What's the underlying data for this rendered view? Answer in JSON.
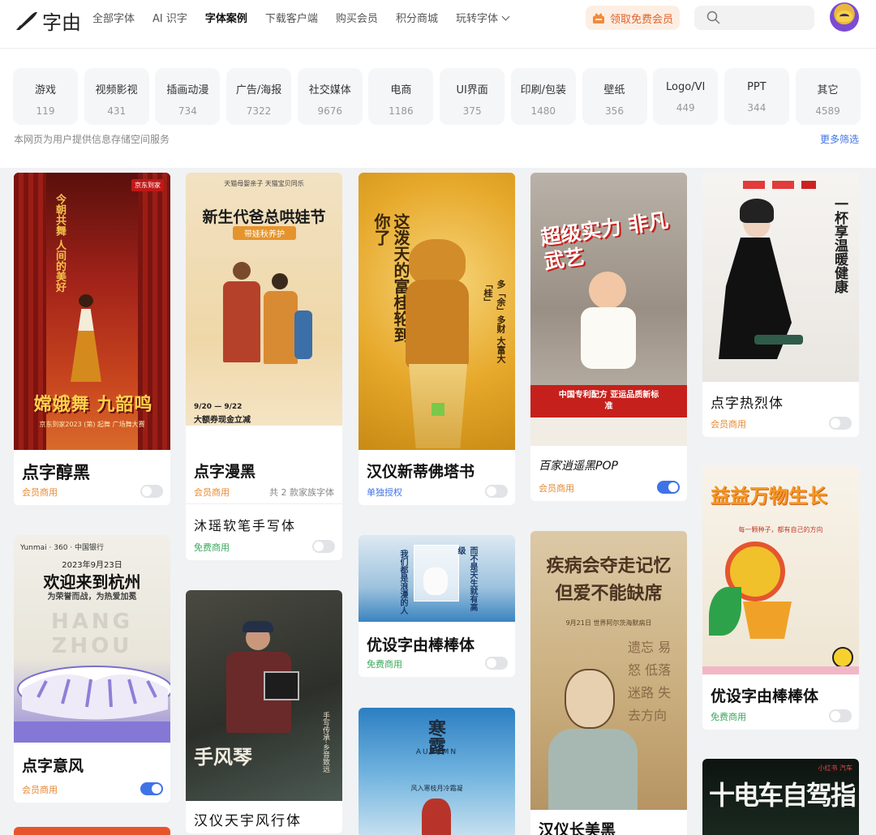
{
  "header": {
    "logo_text": "字由",
    "nav": [
      {
        "label": "全部字体"
      },
      {
        "label": "AI 识字"
      },
      {
        "label": "字体案例"
      },
      {
        "label": "下载客户端"
      },
      {
        "label": "购买会员"
      },
      {
        "label": "积分商城"
      },
      {
        "label": "玩转字体"
      }
    ],
    "vip_button": "领取免费会员",
    "search_placeholder": ""
  },
  "categories": [
    {
      "label": "游戏",
      "count": "119"
    },
    {
      "label": "视频影视",
      "count": "431"
    },
    {
      "label": "插画动漫",
      "count": "734"
    },
    {
      "label": "广告/海报",
      "count": "7322"
    },
    {
      "label": "社交媒体",
      "count": "9676"
    },
    {
      "label": "电商",
      "count": "1186"
    },
    {
      "label": "UI界面",
      "count": "375"
    },
    {
      "label": "印刷/包装",
      "count": "1480"
    },
    {
      "label": "壁纸",
      "count": "356"
    },
    {
      "label": "Logo/VI",
      "count": "449"
    },
    {
      "label": "PPT",
      "count": "344"
    },
    {
      "label": "其它",
      "count": "4589"
    }
  ],
  "notice": "本网页为用户提供信息存储空间服务",
  "more_filter": "更多筛选",
  "cards": {
    "c1": {
      "title": "点字醇黑",
      "license": "会员商用",
      "toggle_on": false,
      "poster_text": "嫦娥舞 九韶鸣",
      "poster_small": "京东到家2023 (第) 起舞 广场舞大赛",
      "poster_top": "京东到家",
      "poster_side": "今朝共舞 人间的美好"
    },
    "c2": {
      "title": "点字漫黑",
      "license": "会员商用",
      "family": "共 2 款家族字体",
      "title2": "沐瑶软笔手写体",
      "license2": "免费商用",
      "toggle_on": false,
      "poster_headline": "新生代爸总哄娃节",
      "poster_sub": "带娃秋养护",
      "poster_date": "9/20 — 9/22",
      "poster_promo": "大额券现金立减",
      "poster_top": "天猫母婴亲子 天猫宝贝同乐"
    },
    "c3": {
      "title": "汉仪新蒂佛塔书",
      "license": "单独授权",
      "toggle_on": false,
      "poster_big": "这泼天的富桂轮到你了",
      "poster_side": "多「余」多财 大富大「桂」"
    },
    "c4": {
      "title": "百家逍遥黑POP",
      "license": "会员商用",
      "toggle_on": true,
      "poster_big": "超级实力 非凡武艺",
      "poster_banner": "中国专利配方 亚运品质新标准"
    },
    "c5": {
      "title": "点字热烈体",
      "license": "会员商用",
      "toggle_on": false,
      "poster_side": "一杯享温暖健康"
    },
    "c6": {
      "title": "优设字由棒棒体",
      "license": "免费商用",
      "toggle_on": false,
      "poster_big": "我们都是浪漫的人",
      "poster_side": "而不是天生就有高级"
    },
    "c7": {
      "title": "点字意风",
      "license": "会员商用",
      "toggle_on": true,
      "poster_date": "2023年9月23日",
      "poster_big": "欢迎来到杭州",
      "poster_sub": "为荣誉而战，为热爱加冕",
      "poster_city": "HANG ZHOU",
      "poster_brand": "Yunmai · 360 · 中国银行"
    },
    "c8": {
      "title": "汉仪天宇风行体",
      "poster_big": "手风琴",
      "poster_side": "手写传承·乡音致远"
    },
    "c9": {
      "title": "汉仪长美黑",
      "poster_big": "疾病会夺走记忆 但爱不能缺席",
      "poster_date": "9月21日 世界阿尔茨海默病日",
      "poster_words": "遗忘 易怒 低落 迷路 失去方向"
    },
    "c10": {
      "title": "优设字由棒棒体",
      "license": "免费商用",
      "toggle_on": false,
      "poster_big": "益益万物生长",
      "poster_sub": "每一颗种子，都有自己的方向"
    },
    "c11": {
      "poster_big": "寒露",
      "poster_en": "AUTUMN",
      "poster_sub": "风入寒枝月冷霜凝"
    },
    "c12": {
      "poster_big": "十电车自驾指南",
      "poster_top": "小红书 汽车"
    }
  }
}
